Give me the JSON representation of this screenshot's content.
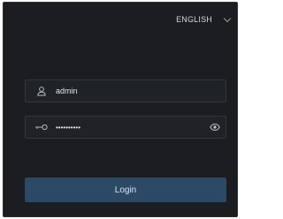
{
  "language": {
    "label": "ENGLISH",
    "icon": "chevron-down-icon"
  },
  "username": {
    "icon": "user-icon",
    "value": "admin"
  },
  "password": {
    "icon": "key-icon",
    "value": "••••••••••",
    "toggle_icon": "eye-icon"
  },
  "login": {
    "label": "Login"
  },
  "colors": {
    "background": "#1b1d21",
    "field_bg": "#1f2226",
    "field_border": "#33373d",
    "button": "#2c4a66",
    "text": "#e6e8eb"
  }
}
